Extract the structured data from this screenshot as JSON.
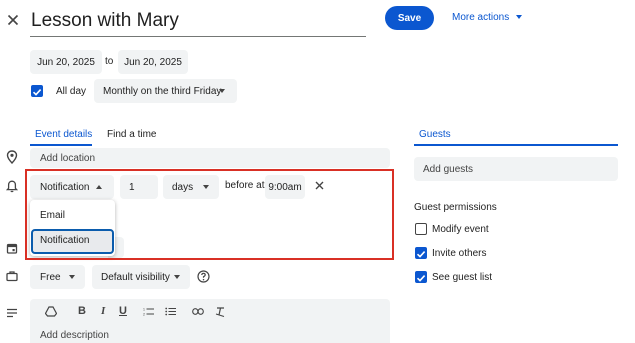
{
  "header": {
    "close_icon": "close-icon",
    "title": "Lesson with Mary",
    "save_label": "Save",
    "more_actions_label": "More actions"
  },
  "dates": {
    "start": "Jun 20, 2025",
    "to_label": "to",
    "end": "Jun 20, 2025",
    "all_day_label": "All day",
    "all_day_checked": true,
    "recurrence": "Monthly on the third Friday"
  },
  "tabs": {
    "event_details": "Event details",
    "find_time": "Find a time",
    "guests": "Guests"
  },
  "location": {
    "placeholder": "Add location"
  },
  "notification": {
    "type": "Notification",
    "amount": "1",
    "unit": "days",
    "before_at_label": "before at",
    "time": "9:00am",
    "dropdown_options": [
      "Email",
      "Notification"
    ],
    "selected_option": "Notification"
  },
  "visibility": {
    "status": "Free",
    "visibility": "Default visibility"
  },
  "description": {
    "placeholder": "Add description"
  },
  "guests_panel": {
    "add_guests_placeholder": "Add guests",
    "permissions_title": "Guest permissions",
    "permissions": [
      {
        "label": "Modify event",
        "checked": false
      },
      {
        "label": "Invite others",
        "checked": true
      },
      {
        "label": "See guest list",
        "checked": true
      }
    ]
  },
  "colors": {
    "accent": "#0b57d0",
    "highlight_border": "#d93025",
    "selected_outline": "#0b5cad",
    "field_bg": "#f1f3f4"
  }
}
